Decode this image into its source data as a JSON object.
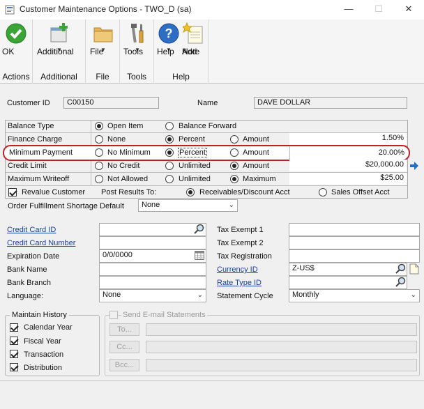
{
  "window": {
    "title": "Customer Maintenance Options  -  TWO_D (sa)"
  },
  "ribbon": {
    "ok": "OK",
    "additional": "Additional",
    "file": "File",
    "tools": "Tools",
    "help": "Help",
    "add_note_line1": "Add",
    "add_note_line2": "Note",
    "group_actions": "Actions",
    "group_additional": "Additional",
    "group_file": "File",
    "group_tools": "Tools",
    "group_help": "Help"
  },
  "customer": {
    "id_label": "Customer ID",
    "id_value": "C00150",
    "name_label": "Name",
    "name_value": "DAVE DOLLAR"
  },
  "grid": {
    "balance_type": {
      "label": "Balance Type",
      "opt1": "Open Item",
      "opt2": "Balance Forward"
    },
    "finance_charge": {
      "label": "Finance Charge",
      "opt1": "None",
      "opt2": "Percent",
      "opt3": "Amount",
      "value": "1.50%"
    },
    "minimum_payment": {
      "label": "Minimum Payment",
      "opt1": "No Minimum",
      "opt2": "Percent",
      "opt3": "Amount",
      "value": "20.00%"
    },
    "credit_limit": {
      "label": "Credit Limit",
      "opt1": "No Credit",
      "opt2": "Unlimited",
      "opt3": "Amount",
      "value": "$20,000.00"
    },
    "maximum_writeoff": {
      "label": "Maximum Writeoff",
      "opt1": "Not Allowed",
      "opt2": "Unlimited",
      "opt3": "Maximum",
      "value": "$25.00"
    },
    "revalue": {
      "label": "Revalue Customer",
      "post_label": "Post Results To:",
      "opt1": "Receivables/Discount Acct",
      "opt2": "Sales Offset Acct"
    }
  },
  "order_shortage": {
    "label": "Order Fulfillment Shortage Default",
    "value": "None"
  },
  "left_fields": {
    "credit_card_id": "Credit Card ID",
    "credit_card_number": "Credit Card Number",
    "expiration_date": "Expiration Date",
    "expiration_value": "0/0/0000",
    "bank_name": "Bank Name",
    "bank_branch": "Bank Branch",
    "language": "Language:",
    "language_value": "None"
  },
  "right_fields": {
    "tax_exempt_1": "Tax Exempt 1",
    "tax_exempt_2": "Tax Exempt 2",
    "tax_registration": "Tax Registration",
    "currency_id": "Currency ID",
    "currency_value": "Z-US$",
    "rate_type_id": "Rate Type ID",
    "statement_cycle": "Statement Cycle",
    "statement_value": "Monthly"
  },
  "history": {
    "title": "Maintain History",
    "calendar_year": "Calendar Year",
    "fiscal_year": "Fiscal Year",
    "transaction": "Transaction",
    "distribution": "Distribution"
  },
  "email": {
    "send_label": "Send E-mail Statements",
    "to": "To...",
    "cc": "Cc...",
    "bcc": "Bcc..."
  },
  "colors": {
    "highlight_ring": "#c0202a",
    "link": "#1a3fa6",
    "arrow_blue": "#1e6fc8"
  }
}
